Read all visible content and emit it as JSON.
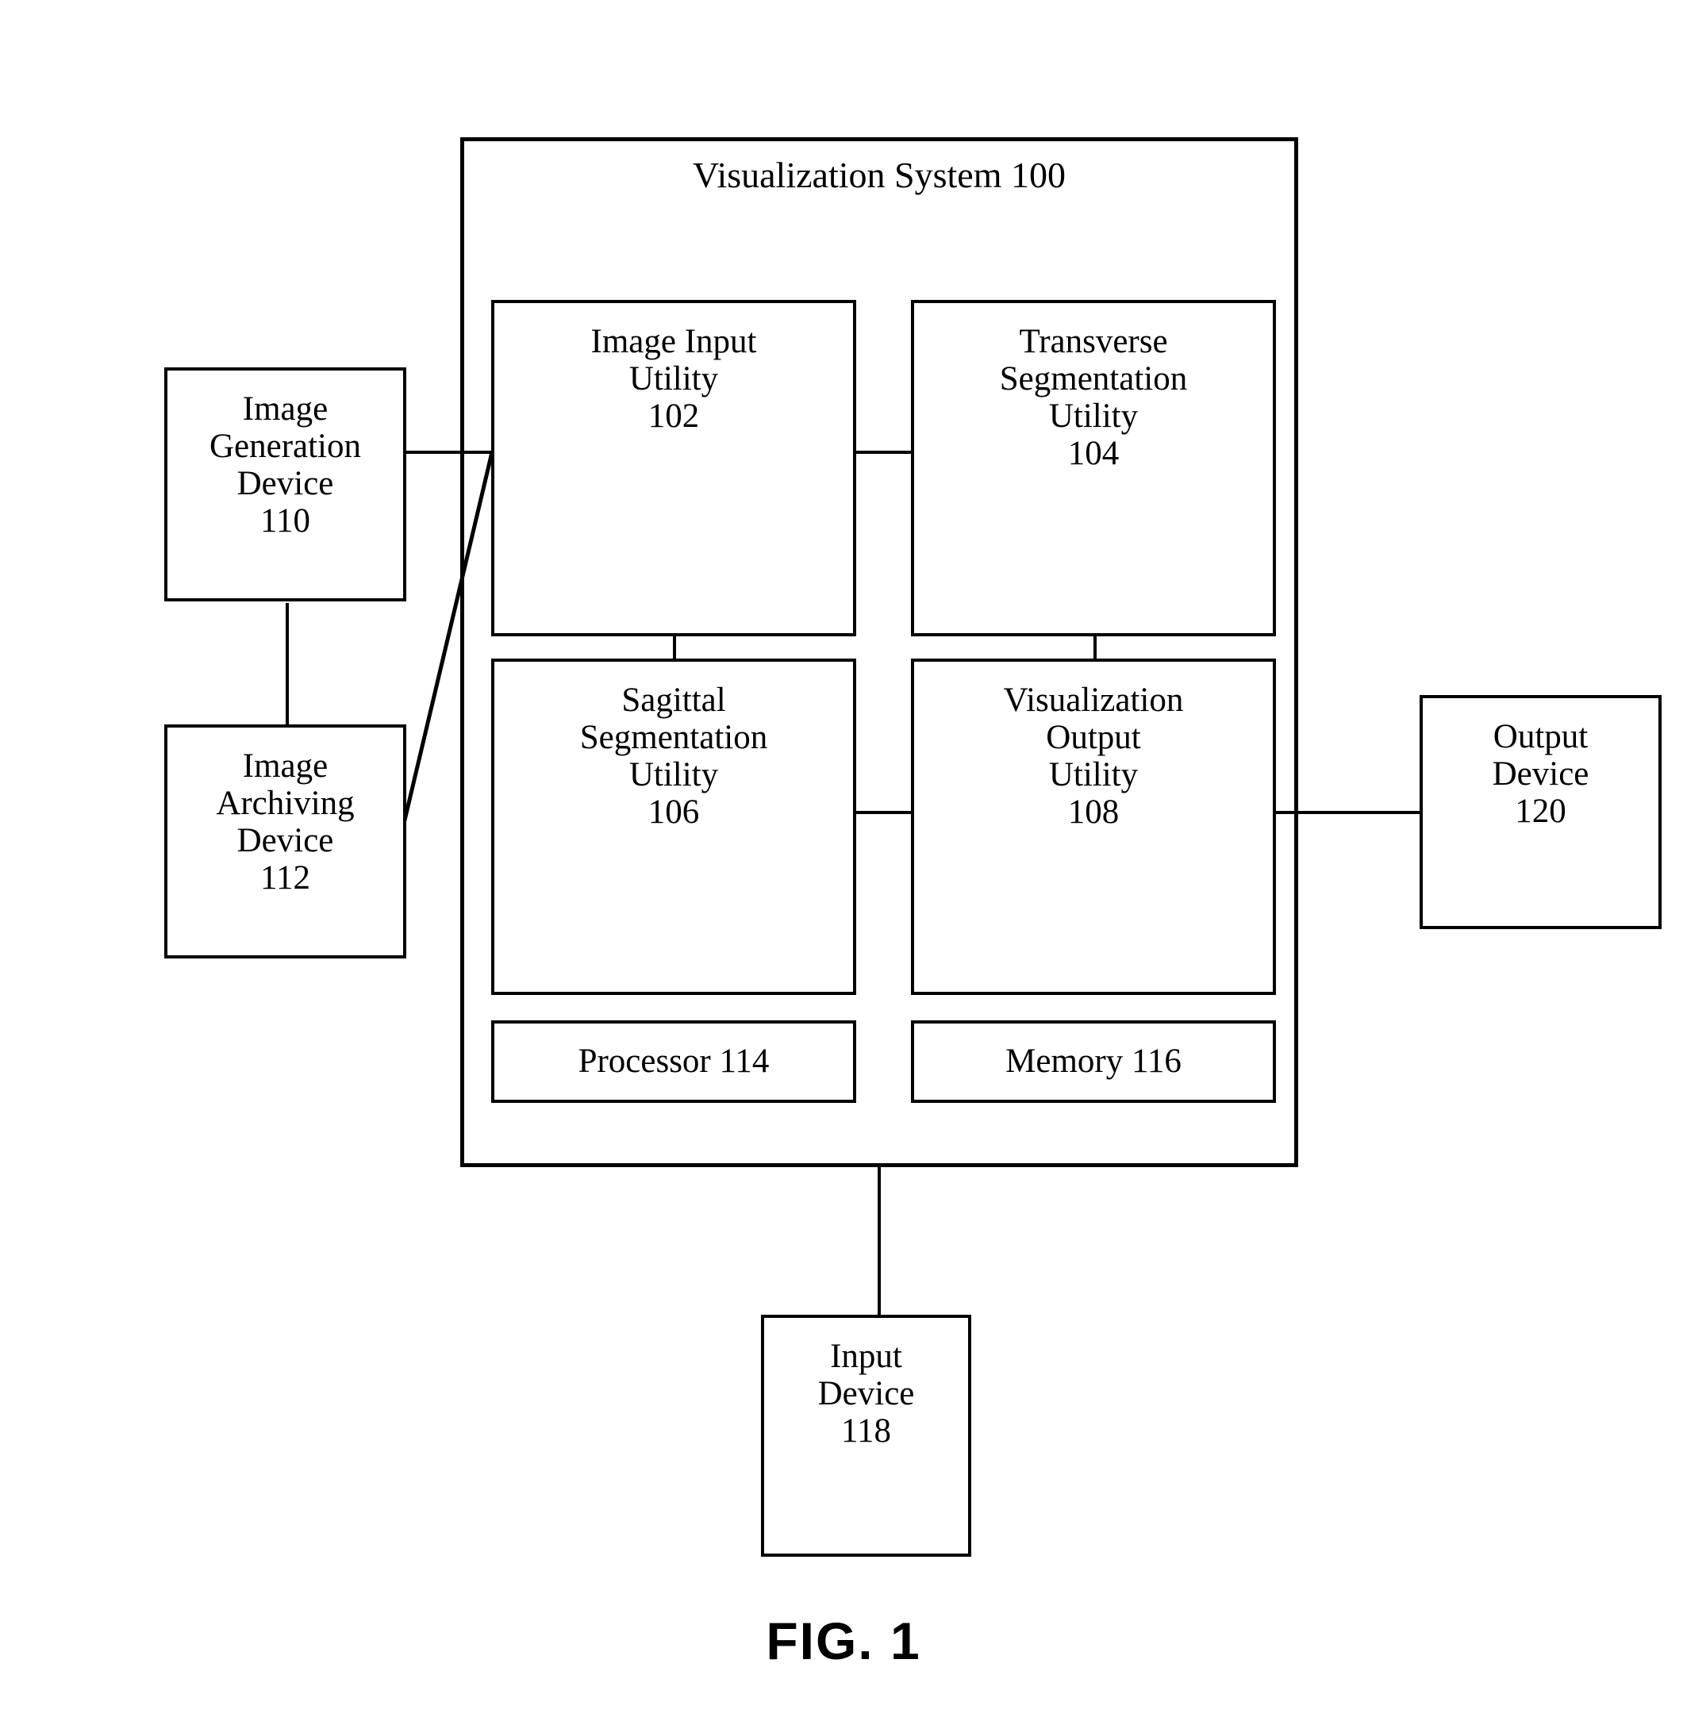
{
  "figure": {
    "caption": "FIG. 1",
    "system_title": "Visualization System 100"
  },
  "system": {
    "modules": [
      {
        "id": "image-input-utility",
        "label": "Image Input\nUtility\n102",
        "reference_numeral": "102"
      },
      {
        "id": "transverse-segmentation-utility",
        "label": "Transverse\nSegmentation\nUtility\n104",
        "reference_numeral": "104"
      },
      {
        "id": "sagittal-segmentation-utility",
        "label": "Sagittal\nSegmentation\nUtility\n106",
        "reference_numeral": "106"
      },
      {
        "id": "visualization-output-utility",
        "label": "Visualization\nOutput\nUtility\n108",
        "reference_numeral": "108"
      }
    ],
    "hardware": [
      {
        "id": "processor",
        "label": "Processor 114",
        "reference_numeral": "114"
      },
      {
        "id": "memory",
        "label": "Memory 116",
        "reference_numeral": "116"
      }
    ]
  },
  "external_devices": [
    {
      "id": "image-generation-device",
      "label": "Image\nGeneration\nDevice\n110",
      "reference_numeral": "110"
    },
    {
      "id": "image-archiving-device",
      "label": "Image\nArchiving\nDevice\n112",
      "reference_numeral": "112"
    },
    {
      "id": "output-device",
      "label": "Output\nDevice\n120",
      "reference_numeral": "120"
    },
    {
      "id": "input-device",
      "label": "Input\nDevice\n118",
      "reference_numeral": "118"
    }
  ],
  "colors": {
    "stroke": "#000000",
    "background": "#ffffff"
  }
}
